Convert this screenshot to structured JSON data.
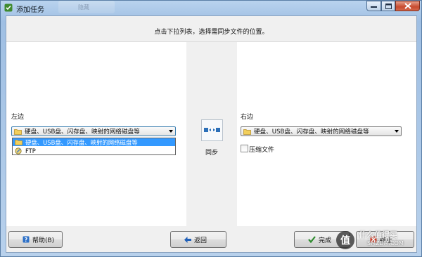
{
  "window": {
    "title": "添加任务",
    "background_tab": "隐藏"
  },
  "header": {
    "instruction": "点击下拉列表，选择需同步文件的位置。"
  },
  "left": {
    "label": "左边",
    "selected": "硬盘、USB盘、闪存盘、映射的网络磁盘等",
    "options": [
      {
        "label": "硬盘、USB盘、闪存盘、映射的网络磁盘等",
        "icon": "folder-icon",
        "highlighted": true
      },
      {
        "label": "FTP",
        "icon": "ftp-icon",
        "highlighted": false
      }
    ]
  },
  "middle": {
    "sync_label": "同步",
    "icon": "sync-icon"
  },
  "right": {
    "label": "右边",
    "selected": "硬盘、USB盘、闪存盘、映射的网络磁盘等",
    "compress_label": "压缩文件",
    "compress_checked": false
  },
  "footer": {
    "help": "帮助(B)",
    "back": "返回",
    "finish": "完成",
    "cancel": "终止"
  },
  "watermark": {
    "text": "什么值得买",
    "url": "SMZDM.COM",
    "mark": "值"
  },
  "colors": {
    "title_gradient_top": "#b9d3ee",
    "selection": "#3399ff",
    "close_button": "#c74b2f"
  }
}
